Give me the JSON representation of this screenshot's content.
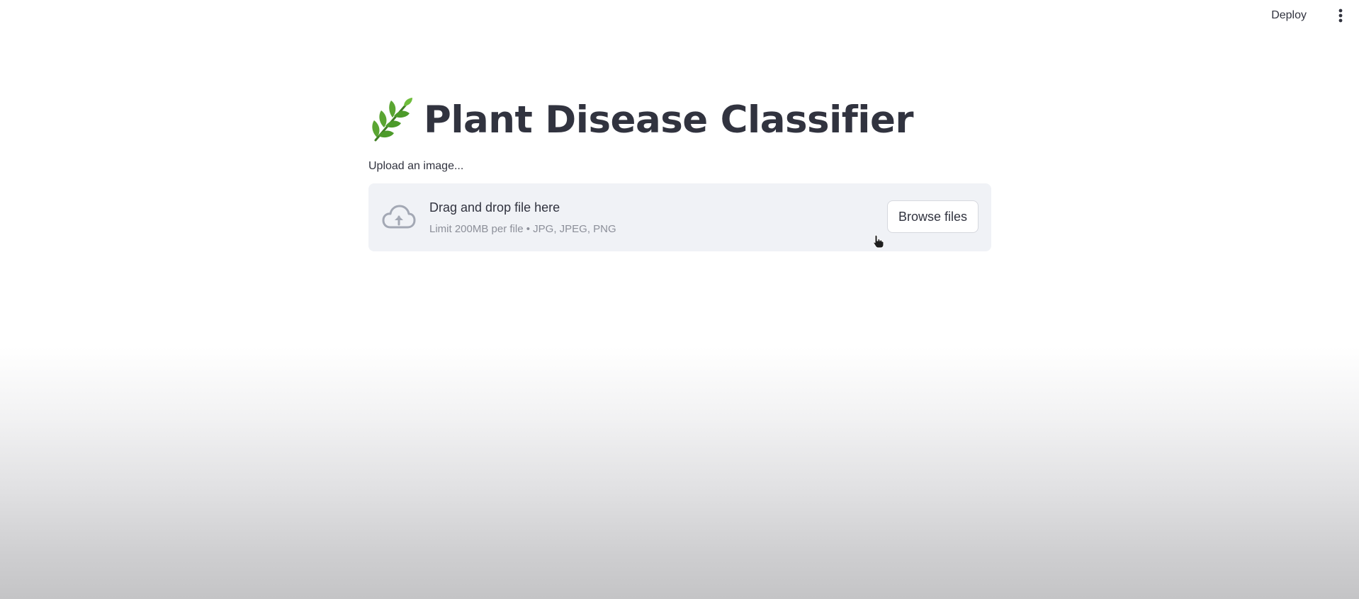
{
  "header": {
    "deploy_label": "Deploy",
    "menu_icon": "vertical-dots-icon"
  },
  "main": {
    "title_emoji_icon": "herb-leaf-icon",
    "title": "Plant Disease Classifier",
    "upload_label": "Upload an image...",
    "dropzone": {
      "icon": "cloud-upload-icon",
      "title": "Drag and drop file here",
      "limit_text": "Limit 200MB per file • JPG, JPEG, PNG",
      "browse_label": "Browse files"
    }
  },
  "colors": {
    "text": "#31333f",
    "muted_text": "#8c8f99",
    "dropzone_bg": "#f0f2f6",
    "button_border": "#d6d8de",
    "leaf_green": "#4c9a2a"
  }
}
